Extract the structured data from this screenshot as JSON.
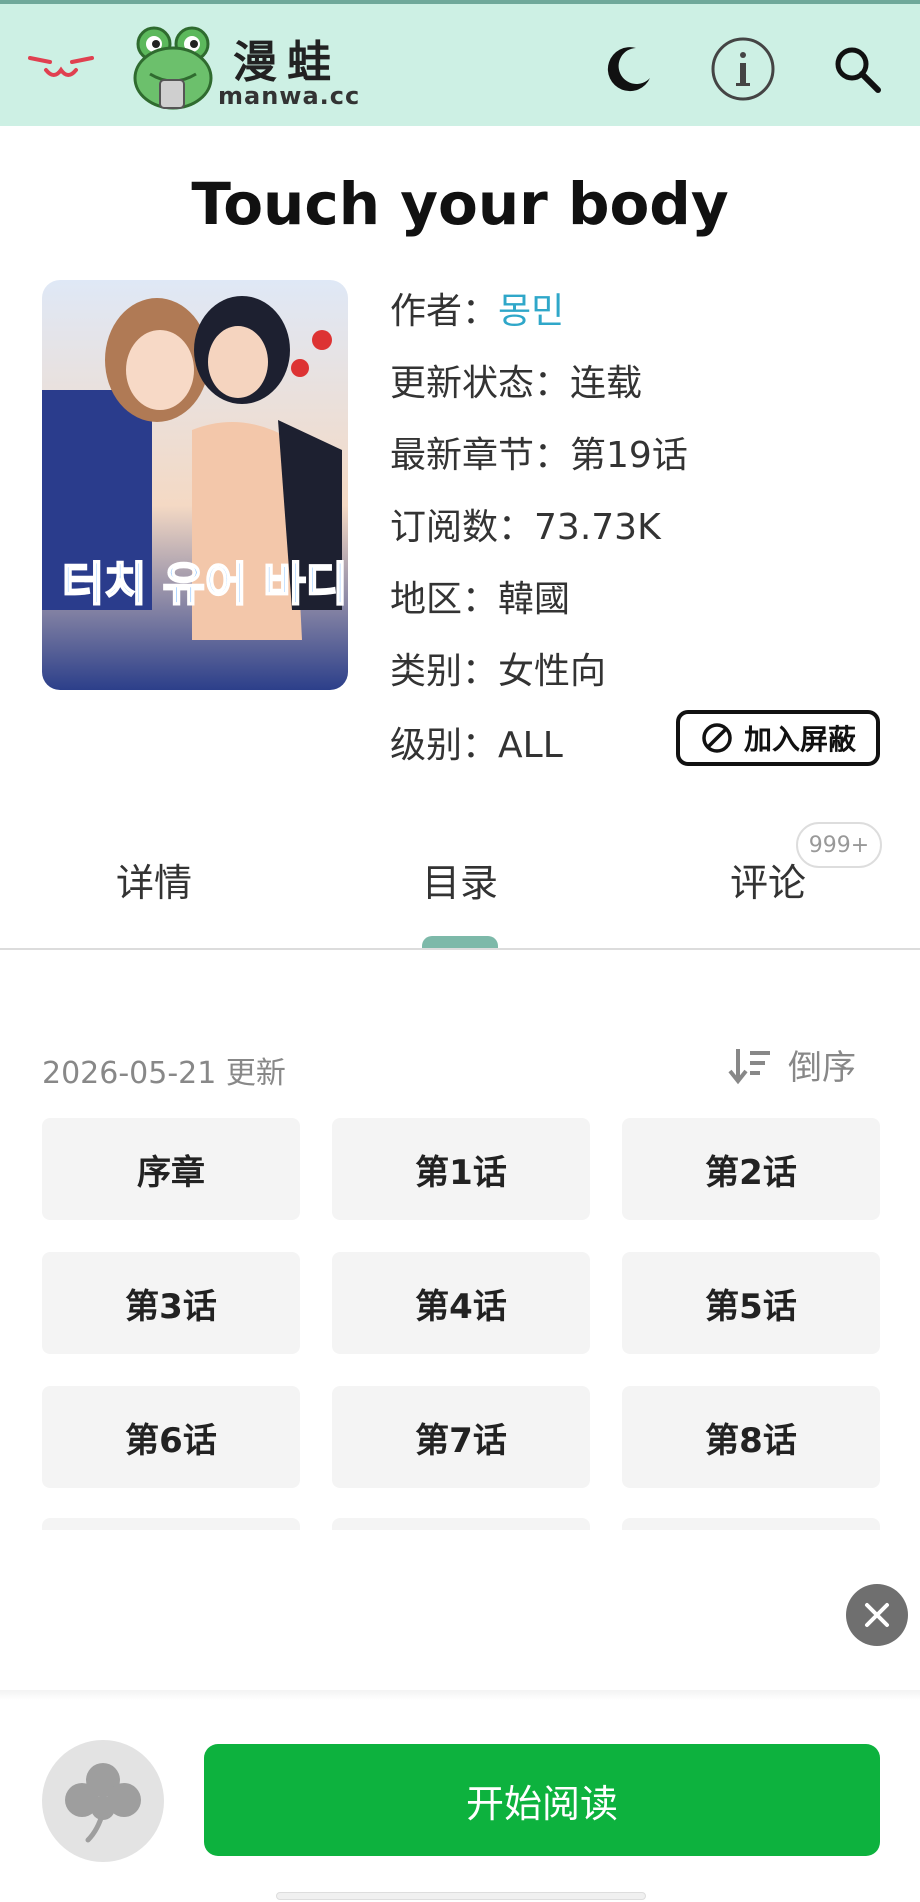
{
  "header": {
    "logo_title": "漫蛙",
    "logo_sub": "manwa.cc",
    "icons": [
      "menu-icon",
      "moon-icon",
      "info-icon",
      "search-icon"
    ]
  },
  "book": {
    "title": "Touch your body",
    "info": [
      {
        "label": "作者：",
        "value": "몽민"
      },
      {
        "label": "更新状态：",
        "value": "连载"
      },
      {
        "label": "最新章节：",
        "value": "第19话"
      },
      {
        "label": "订阅数：",
        "value": "73.73K"
      },
      {
        "label": "地区：",
        "value": "韓國"
      },
      {
        "label": "类别：",
        "value": "女性向"
      },
      {
        "label": "级别：",
        "value": "ALL"
      }
    ],
    "block_label": "加入屏蔽",
    "cover_text": "터치 유어 바디"
  },
  "tabs": [
    {
      "label": "详情"
    },
    {
      "label": "目录"
    },
    {
      "label": "评论"
    }
  ],
  "comments_badge": "999+",
  "toc": {
    "updated": "2026-05-21 更新",
    "sort_label": "倒序",
    "chapters": [
      "序章",
      "第1话",
      "第2话",
      "第3话",
      "第4话",
      "第5话",
      "第6话",
      "第7话",
      "第8话"
    ]
  },
  "bottom": {
    "read_label": "开始阅读"
  },
  "colors": {
    "header_bg": "#cdf0e4",
    "accent": "#7db9a9",
    "link": "#2fa7c9",
    "read_button": "#0db23e"
  }
}
